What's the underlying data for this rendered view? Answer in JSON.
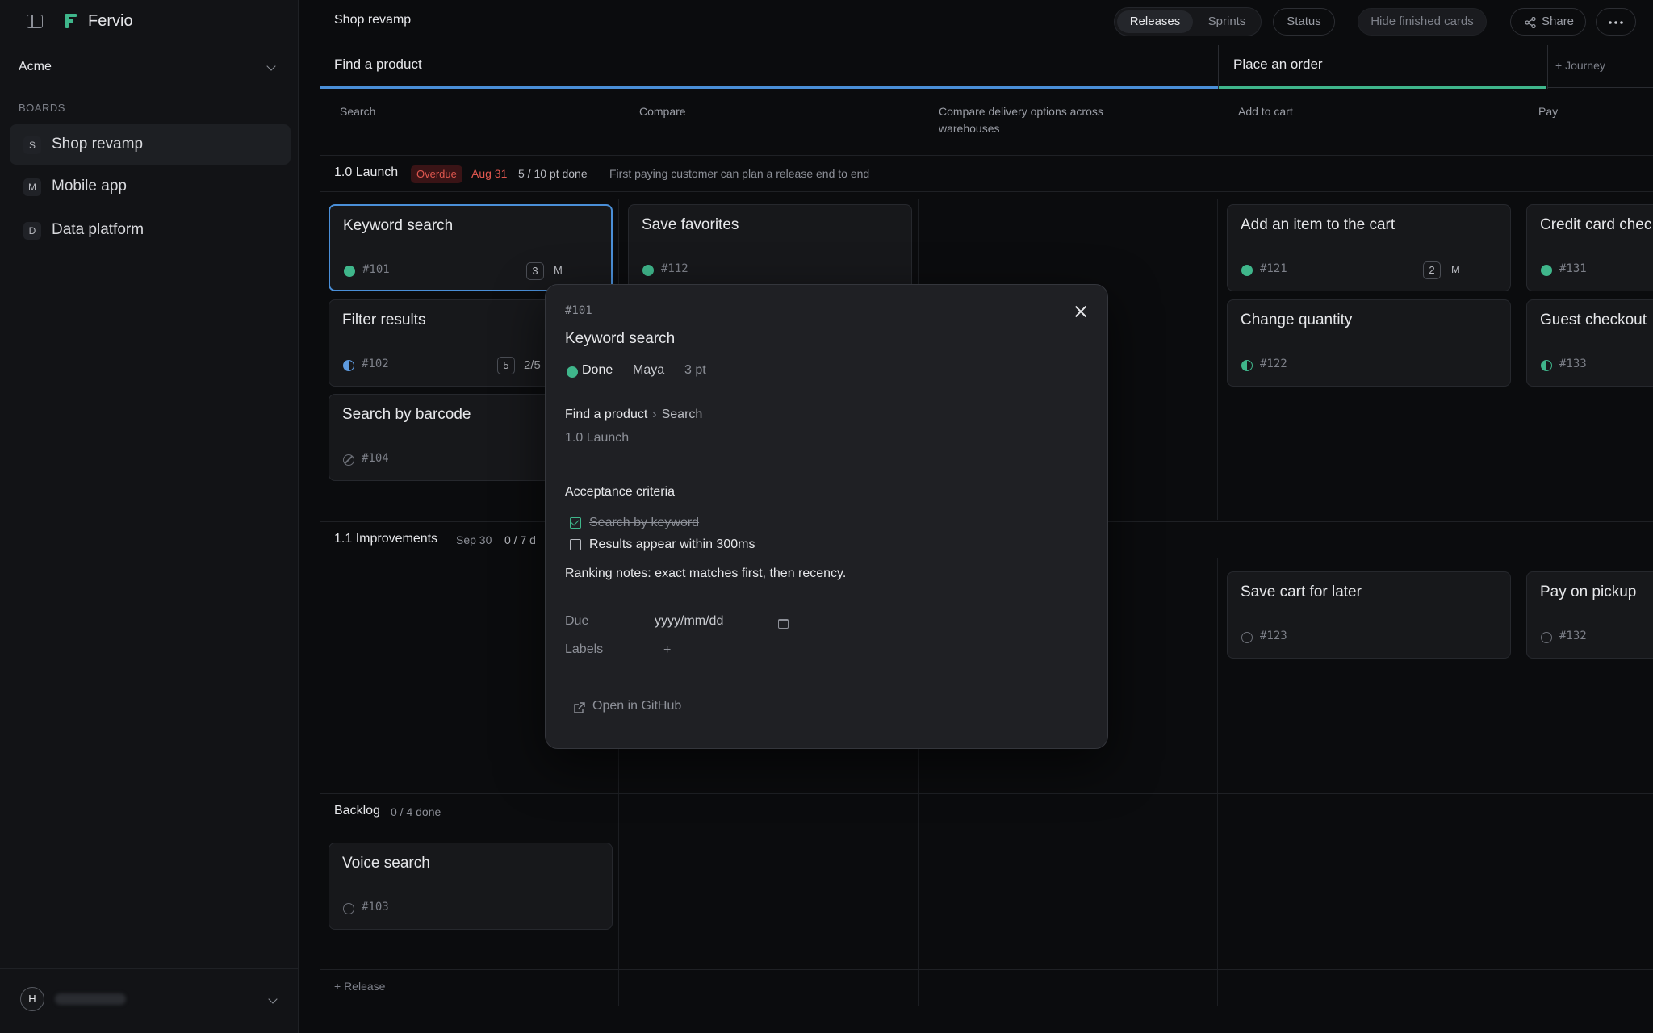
{
  "app": {
    "brand": "Fervio",
    "org": "Acme",
    "boards_heading": "BOARDS",
    "boards": [
      {
        "mono": "S",
        "name": "Shop revamp",
        "active": true
      },
      {
        "mono": "M",
        "name": "Mobile app",
        "active": false
      },
      {
        "mono": "D",
        "name": "Data platform",
        "active": false
      }
    ],
    "user_initial": "H"
  },
  "topbar": {
    "title": "Shop revamp",
    "view_releases": "Releases",
    "view_sprints": "Sprints",
    "status": "Status",
    "hide_finished": "Hide finished cards",
    "share": "Share"
  },
  "journeys": [
    {
      "name": "Find a product",
      "color": "#4a8fd8"
    },
    {
      "name": "Place an order",
      "color": "#3fb68b"
    }
  ],
  "add_journey": "+ Journey",
  "steps": [
    "Search",
    "Compare",
    "Compare delivery options across warehouses",
    "Add to cart",
    "Pay"
  ],
  "releases": [
    {
      "name": "1.0 Launch",
      "overdue": "Overdue",
      "date": "Aug 31",
      "progress": "5 / 10 pt done",
      "goal": "First paying customer can plan a release end to end"
    },
    {
      "name": "1.1 Improvements",
      "date": "Sep 30",
      "progress": "0 / 7 d"
    },
    {
      "name": "Backlog",
      "progress": "0 / 4 done"
    }
  ],
  "add_release": "+ Release",
  "cards": {
    "c101": {
      "title": "Keyword search",
      "id": "#101",
      "est": "3",
      "owner": "M"
    },
    "c102": {
      "title": "Filter results",
      "id": "#102",
      "est": "5",
      "extra": "2/5"
    },
    "c104": {
      "title": "Search by barcode",
      "id": "#104"
    },
    "c112": {
      "title": "Save favorites",
      "id": "#112"
    },
    "c121": {
      "title": "Add an item to the cart",
      "id": "#121",
      "est": "2",
      "owner": "M"
    },
    "c122": {
      "title": "Change quantity",
      "id": "#122"
    },
    "c131": {
      "title": "Credit card chec",
      "id": "#131"
    },
    "c133": {
      "title": "Guest checkout",
      "id": "#133"
    },
    "c123": {
      "title": "Save cart for later",
      "id": "#123"
    },
    "c132": {
      "title": "Pay on pickup",
      "id": "#132"
    },
    "c103": {
      "title": "Voice search",
      "id": "#103"
    }
  },
  "modal": {
    "id": "#101",
    "title": "Keyword search",
    "status": "Done",
    "assignee": "Maya",
    "points": "3 pt",
    "journey": "Find a product",
    "sep": "›",
    "step": "Search",
    "release": "1.0 Launch",
    "criteria_heading": "Acceptance criteria",
    "criteria": [
      {
        "text": "Search by keyword",
        "done": true
      },
      {
        "text": "Results appear within 300ms",
        "done": false
      }
    ],
    "notes": "Ranking notes: exact matches first, then recency.",
    "due_label": "Due",
    "due_placeholder": "yyyy/mm/dd",
    "labels_label": "Labels",
    "add_label": "+",
    "github": "Open in GitHub"
  }
}
